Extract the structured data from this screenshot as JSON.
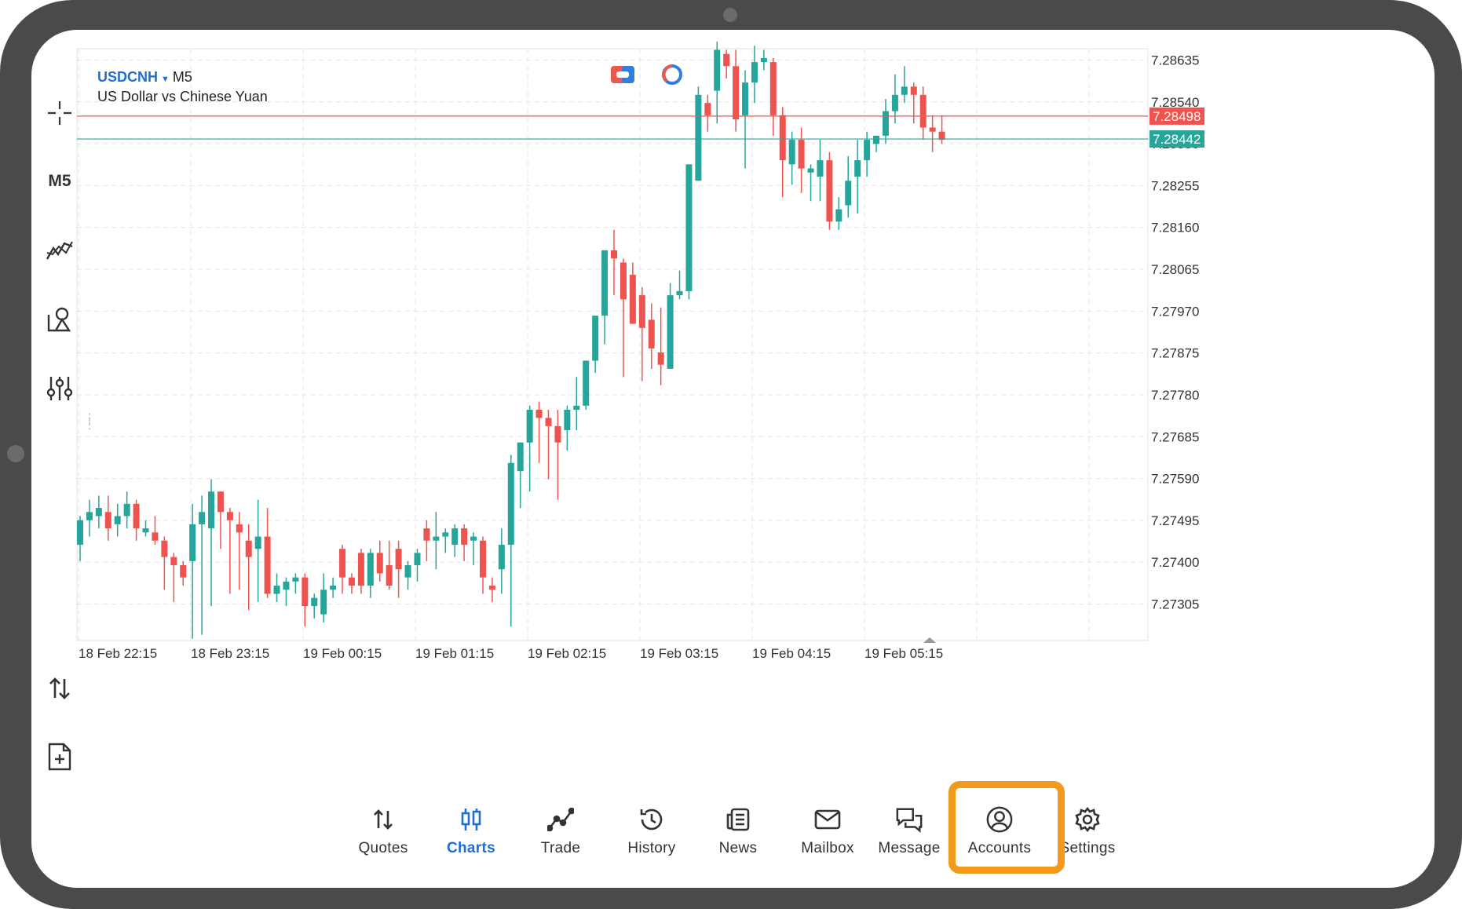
{
  "chart_header": {
    "symbol": "USDCNH",
    "timeframe": "M5",
    "description": "US Dollar vs Chinese Yuan"
  },
  "toolbar": {
    "timeframe_label": "M5",
    "icons": [
      "crosshair-icon",
      "timeframe-text",
      "indicators-icon",
      "objects-icon",
      "settings-sliders-icon",
      "trade-arrows-icon",
      "new-order-icon"
    ]
  },
  "price_levels": {
    "bid": "7.28442",
    "ask": "7.28498",
    "bid_color": "#26a69a",
    "ask_color": "#ef5350"
  },
  "chart_data": {
    "type": "candlestick",
    "symbol": "USDCNH",
    "timeframe": "M5",
    "y_ticks": [
      "7.28635",
      "7.28540",
      "7.28350",
      "7.28255",
      "7.28160",
      "7.28065",
      "7.27970",
      "7.27875",
      "7.27780",
      "7.27685",
      "7.27590",
      "7.27495",
      "7.27400",
      "7.27305"
    ],
    "x_ticks": [
      "18 Feb 22:15",
      "18 Feb 23:15",
      "19 Feb 00:15",
      "19 Feb 01:15",
      "19 Feb 02:15",
      "19 Feb 03:15",
      "19 Feb 04:15",
      "19 Feb 05:15"
    ],
    "ylim": [
      7.2723,
      7.2868
    ],
    "up_color": "#26a69a",
    "down_color": "#ef5350",
    "grid": true,
    "candles": [
      {
        "o": 7.2745,
        "h": 7.2752,
        "l": 7.2741,
        "c": 7.2751
      },
      {
        "o": 7.2751,
        "h": 7.2756,
        "l": 7.2747,
        "c": 7.2753
      },
      {
        "o": 7.2752,
        "h": 7.2757,
        "l": 7.2749,
        "c": 7.2754
      },
      {
        "o": 7.2753,
        "h": 7.2757,
        "l": 7.2746,
        "c": 7.2749
      },
      {
        "o": 7.275,
        "h": 7.2755,
        "l": 7.2747,
        "c": 7.2752
      },
      {
        "o": 7.2752,
        "h": 7.2758,
        "l": 7.2749,
        "c": 7.2755
      },
      {
        "o": 7.2755,
        "h": 7.2756,
        "l": 7.2746,
        "c": 7.2749
      },
      {
        "o": 7.2748,
        "h": 7.2751,
        "l": 7.2747,
        "c": 7.2749
      },
      {
        "o": 7.2748,
        "h": 7.2752,
        "l": 7.2745,
        "c": 7.2746
      },
      {
        "o": 7.2746,
        "h": 7.2747,
        "l": 7.2734,
        "c": 7.2742
      },
      {
        "o": 7.2742,
        "h": 7.2743,
        "l": 7.2731,
        "c": 7.274
      },
      {
        "o": 7.274,
        "h": 7.2741,
        "l": 7.2735,
        "c": 7.2737
      },
      {
        "o": 7.2741,
        "h": 7.2755,
        "l": 7.2722,
        "c": 7.275
      },
      {
        "o": 7.275,
        "h": 7.2757,
        "l": 7.2723,
        "c": 7.2753
      },
      {
        "o": 7.2749,
        "h": 7.2761,
        "l": 7.273,
        "c": 7.2758
      },
      {
        "o": 7.2758,
        "h": 7.2758,
        "l": 7.2744,
        "c": 7.2753
      },
      {
        "o": 7.2753,
        "h": 7.2754,
        "l": 7.2733,
        "c": 7.2751
      },
      {
        "o": 7.275,
        "h": 7.2753,
        "l": 7.2734,
        "c": 7.2748
      },
      {
        "o": 7.2746,
        "h": 7.275,
        "l": 7.2729,
        "c": 7.2742
      },
      {
        "o": 7.2744,
        "h": 7.2756,
        "l": 7.2731,
        "c": 7.2747
      },
      {
        "o": 7.2747,
        "h": 7.2754,
        "l": 7.2732,
        "c": 7.2733
      },
      {
        "o": 7.2733,
        "h": 7.2738,
        "l": 7.2731,
        "c": 7.2735
      },
      {
        "o": 7.2734,
        "h": 7.2737,
        "l": 7.273,
        "c": 7.2736
      },
      {
        "o": 7.2736,
        "h": 7.2738,
        "l": 7.2733,
        "c": 7.2737
      },
      {
        "o": 7.2737,
        "h": 7.2738,
        "l": 7.2725,
        "c": 7.273
      },
      {
        "o": 7.273,
        "h": 7.2733,
        "l": 7.2727,
        "c": 7.2732
      },
      {
        "o": 7.2728,
        "h": 7.2738,
        "l": 7.2726,
        "c": 7.2734
      },
      {
        "o": 7.2734,
        "h": 7.2737,
        "l": 7.2732,
        "c": 7.2735
      },
      {
        "o": 7.2744,
        "h": 7.2745,
        "l": 7.2733,
        "c": 7.2737
      },
      {
        "o": 7.2737,
        "h": 7.2738,
        "l": 7.2733,
        "c": 7.2735
      },
      {
        "o": 7.2743,
        "h": 7.2744,
        "l": 7.2733,
        "c": 7.2735
      },
      {
        "o": 7.2735,
        "h": 7.2744,
        "l": 7.2732,
        "c": 7.2743
      },
      {
        "o": 7.2743,
        "h": 7.2746,
        "l": 7.2736,
        "c": 7.2738
      },
      {
        "o": 7.274,
        "h": 7.2746,
        "l": 7.2734,
        "c": 7.2735
      },
      {
        "o": 7.2744,
        "h": 7.2746,
        "l": 7.2732,
        "c": 7.2739
      },
      {
        "o": 7.2737,
        "h": 7.2741,
        "l": 7.2734,
        "c": 7.274
      },
      {
        "o": 7.274,
        "h": 7.2744,
        "l": 7.2736,
        "c": 7.2743
      },
      {
        "o": 7.2749,
        "h": 7.2751,
        "l": 7.2741,
        "c": 7.2746
      },
      {
        "o": 7.2746,
        "h": 7.2753,
        "l": 7.2739,
        "c": 7.2747
      },
      {
        "o": 7.2747,
        "h": 7.2749,
        "l": 7.2743,
        "c": 7.2748
      },
      {
        "o": 7.2745,
        "h": 7.275,
        "l": 7.2742,
        "c": 7.2749
      },
      {
        "o": 7.2749,
        "h": 7.275,
        "l": 7.2741,
        "c": 7.2745
      },
      {
        "o": 7.2746,
        "h": 7.2748,
        "l": 7.274,
        "c": 7.2747
      },
      {
        "o": 7.2746,
        "h": 7.2747,
        "l": 7.2733,
        "c": 7.2737
      },
      {
        "o": 7.2735,
        "h": 7.2737,
        "l": 7.2731,
        "c": 7.2734
      },
      {
        "o": 7.2739,
        "h": 7.2749,
        "l": 7.2733,
        "c": 7.2745
      },
      {
        "o": 7.2745,
        "h": 7.2767,
        "l": 7.2725,
        "c": 7.2765
      },
      {
        "o": 7.2763,
        "h": 7.2768,
        "l": 7.2754,
        "c": 7.277
      },
      {
        "o": 7.277,
        "h": 7.2779,
        "l": 7.2758,
        "c": 7.2778
      },
      {
        "o": 7.2778,
        "h": 7.278,
        "l": 7.2765,
        "c": 7.2776
      },
      {
        "o": 7.2776,
        "h": 7.2778,
        "l": 7.2761,
        "c": 7.2774
      },
      {
        "o": 7.2774,
        "h": 7.2778,
        "l": 7.2756,
        "c": 7.277
      },
      {
        "o": 7.2773,
        "h": 7.2779,
        "l": 7.2768,
        "c": 7.2778
      },
      {
        "o": 7.2778,
        "h": 7.2786,
        "l": 7.2773,
        "c": 7.2779
      },
      {
        "o": 7.2779,
        "h": 7.2788,
        "l": 7.2778,
        "c": 7.279
      },
      {
        "o": 7.279,
        "h": 7.2801,
        "l": 7.2787,
        "c": 7.2801
      },
      {
        "o": 7.2801,
        "h": 7.2808,
        "l": 7.2794,
        "c": 7.2817
      },
      {
        "o": 7.2817,
        "h": 7.2822,
        "l": 7.2806,
        "c": 7.2815
      },
      {
        "o": 7.2814,
        "h": 7.2815,
        "l": 7.2786,
        "c": 7.2805
      },
      {
        "o": 7.2811,
        "h": 7.2814,
        "l": 7.2799,
        "c": 7.2799
      },
      {
        "o": 7.2806,
        "h": 7.2808,
        "l": 7.2785,
        "c": 7.2798
      },
      {
        "o": 7.28,
        "h": 7.2804,
        "l": 7.2788,
        "c": 7.2793
      },
      {
        "o": 7.2792,
        "h": 7.2803,
        "l": 7.2784,
        "c": 7.2789
      },
      {
        "o": 7.2788,
        "h": 7.2809,
        "l": 7.2788,
        "c": 7.2806
      },
      {
        "o": 7.2806,
        "h": 7.2812,
        "l": 7.2805,
        "c": 7.2807
      },
      {
        "o": 7.2807,
        "h": 7.2838,
        "l": 7.2805,
        "c": 7.2838
      },
      {
        "o": 7.2834,
        "h": 7.2857,
        "l": 7.2836,
        "c": 7.2855
      },
      {
        "o": 7.2853,
        "h": 7.2855,
        "l": 7.2846,
        "c": 7.285
      },
      {
        "o": 7.2856,
        "h": 7.2868,
        "l": 7.2848,
        "c": 7.2866
      },
      {
        "o": 7.2865,
        "h": 7.2866,
        "l": 7.2859,
        "c": 7.2862
      },
      {
        "o": 7.2862,
        "h": 7.2866,
        "l": 7.2846,
        "c": 7.2849
      },
      {
        "o": 7.285,
        "h": 7.2861,
        "l": 7.2837,
        "c": 7.2858
      },
      {
        "o": 7.2858,
        "h": 7.2867,
        "l": 7.2853,
        "c": 7.2863
      },
      {
        "o": 7.2863,
        "h": 7.2866,
        "l": 7.2861,
        "c": 7.2864
      },
      {
        "o": 7.2863,
        "h": 7.2864,
        "l": 7.2845,
        "c": 7.285
      },
      {
        "o": 7.285,
        "h": 7.2852,
        "l": 7.283,
        "c": 7.2839
      },
      {
        "o": 7.2838,
        "h": 7.2846,
        "l": 7.2833,
        "c": 7.2844
      },
      {
        "o": 7.2844,
        "h": 7.2847,
        "l": 7.2831,
        "c": 7.2837
      },
      {
        "o": 7.2836,
        "h": 7.2838,
        "l": 7.2829,
        "c": 7.2837
      },
      {
        "o": 7.2835,
        "h": 7.2844,
        "l": 7.2829,
        "c": 7.2839
      },
      {
        "o": 7.2839,
        "h": 7.2841,
        "l": 7.2822,
        "c": 7.2824
      },
      {
        "o": 7.2824,
        "h": 7.283,
        "l": 7.2822,
        "c": 7.2827
      },
      {
        "o": 7.2828,
        "h": 7.284,
        "l": 7.2825,
        "c": 7.2834
      },
      {
        "o": 7.2835,
        "h": 7.2844,
        "l": 7.2826,
        "c": 7.2839
      },
      {
        "o": 7.2839,
        "h": 7.2846,
        "l": 7.2835,
        "c": 7.2844
      },
      {
        "o": 7.2843,
        "h": 7.2845,
        "l": 7.2841,
        "c": 7.2845
      },
      {
        "o": 7.2845,
        "h": 7.2854,
        "l": 7.2843,
        "c": 7.2851
      },
      {
        "o": 7.2851,
        "h": 7.286,
        "l": 7.2848,
        "c": 7.2855
      },
      {
        "o": 7.2855,
        "h": 7.2862,
        "l": 7.2853,
        "c": 7.2857
      },
      {
        "o": 7.2857,
        "h": 7.2858,
        "l": 7.2848,
        "c": 7.2855
      },
      {
        "o": 7.2855,
        "h": 7.2857,
        "l": 7.2844,
        "c": 7.2847
      },
      {
        "o": 7.2847,
        "h": 7.285,
        "l": 7.2841,
        "c": 7.2846
      },
      {
        "o": 7.2846,
        "h": 7.285,
        "l": 7.2843,
        "c": 7.2844
      }
    ]
  },
  "bottom_nav": {
    "items": [
      {
        "label": "Quotes",
        "icon": "quotes-arrows-icon"
      },
      {
        "label": "Charts",
        "icon": "charts-candles-icon"
      },
      {
        "label": "Trade",
        "icon": "trade-line-icon"
      },
      {
        "label": "History",
        "icon": "history-clock-icon"
      },
      {
        "label": "News",
        "icon": "news-book-icon"
      },
      {
        "label": "Mailbox",
        "icon": "mailbox-envelope-icon"
      },
      {
        "label": "Message",
        "icon": "message-bubbles-icon"
      },
      {
        "label": "Accounts",
        "icon": "accounts-user-icon"
      },
      {
        "label": "Settings",
        "icon": "settings-gear-icon"
      }
    ],
    "active": "Charts",
    "highlighted": "Accounts",
    "highlight_color": "#f29a1c"
  }
}
